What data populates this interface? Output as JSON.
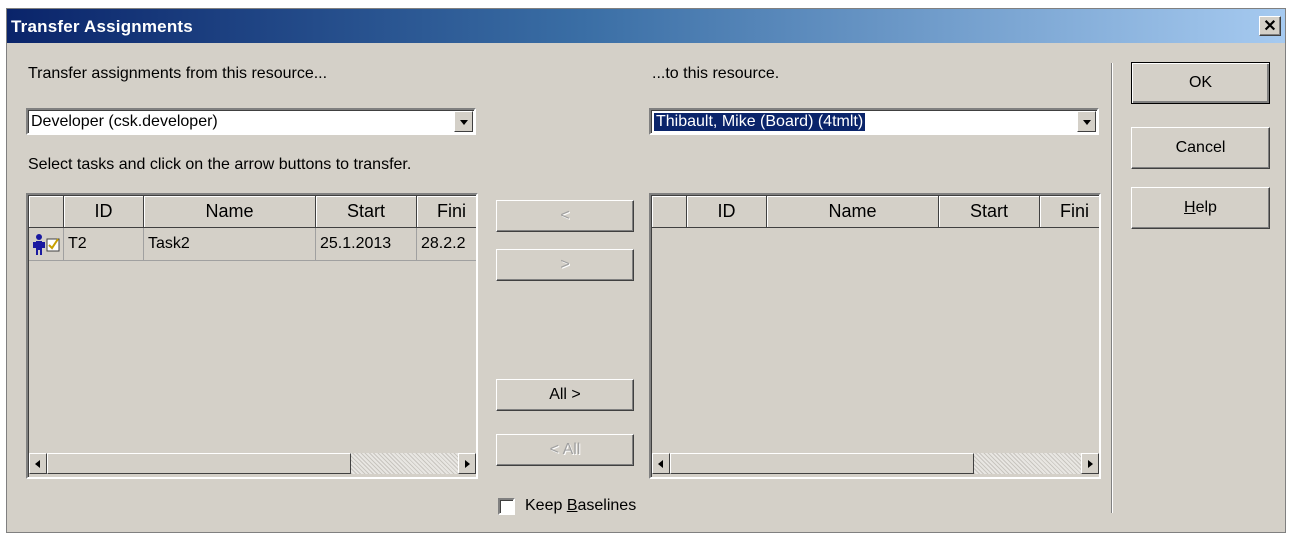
{
  "window": {
    "title": "Transfer Assignments",
    "close_glyph": "✕"
  },
  "from": {
    "label": "Transfer assignments from this resource...",
    "selected": "Developer (csk.developer)",
    "instruction": "Select tasks and click on the arrow buttons to transfer."
  },
  "to": {
    "label": "...to this resource.",
    "selected": "Thibault, Mike (Board) (4tmlt)"
  },
  "columns": [
    "",
    "ID",
    "Name",
    "Start",
    "Fini"
  ],
  "left_rows": [
    {
      "icon": "resource-task-icon",
      "id": "T2",
      "name": "Task2",
      "start": "25.1.2013",
      "finish": "28.2.2"
    }
  ],
  "transfer_buttons": {
    "back": "<",
    "forward": ">",
    "all_forward": "All >",
    "all_back": "< All"
  },
  "keep_baselines": {
    "label_pre": "Keep ",
    "label_u": "B",
    "label_post": "aselines",
    "checked": false
  },
  "side_buttons": {
    "ok": "OK",
    "cancel": "Cancel",
    "help_u": "H",
    "help_rest": "elp"
  }
}
